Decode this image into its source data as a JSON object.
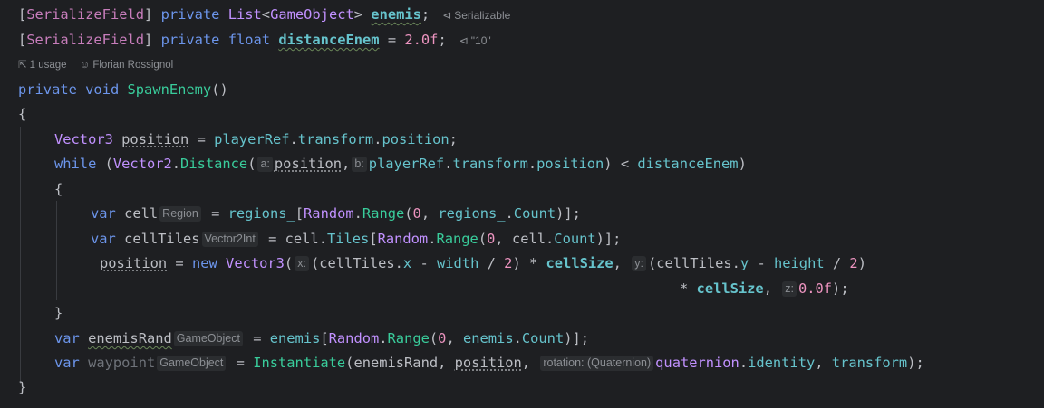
{
  "editor": {
    "field1": {
      "attribute": "SerializeField",
      "modifier": "private",
      "type": "List",
      "generic": "GameObject",
      "name": "enemis",
      "inlay": "Serializable"
    },
    "field2": {
      "attribute": "SerializeField",
      "modifier": "private",
      "type": "float",
      "name": "distanceEnem",
      "value": "2.0f",
      "inlay": "\"10\""
    },
    "meta": {
      "usages": "1 usage",
      "author": "Florian Rossignol"
    },
    "method": {
      "modifier": "private",
      "ret": "void",
      "name": "SpawnEnemy",
      "open_brace": "{",
      "close_brace": "}"
    },
    "hints": {
      "a": "a:",
      "b": "b:",
      "region": "Region",
      "vector2int": "Vector2Int",
      "x": "x:",
      "y": "y:",
      "z": "z:",
      "gameobject1": "GameObject",
      "gameobject2": "GameObject",
      "rotation": "rotation: (Quaternion)"
    },
    "code": {
      "vector3": "Vector3",
      "position": "position",
      "playerRef": "playerRef",
      "transform": "transform",
      "while": "while",
      "vector2": "Vector2",
      "distance": "Distance",
      "distanceEnem": "distanceEnem",
      "var": "var",
      "cell": "cell",
      "regions": "regions_",
      "random": "Random",
      "range": "Range",
      "count": "Count",
      "cellTiles": "cellTiles",
      "tiles": "Tiles",
      "new": "new",
      "x": "x",
      "width": "width",
      "cellSize": "cellSize",
      "y": "y",
      "height": "height",
      "zero": "0",
      "two": "2",
      "zerof": "0.0f",
      "enemisRand": "enemisRand",
      "enemis": "enemis",
      "waypoint": "waypoint",
      "instantiate": "Instantiate",
      "quaternion": "quaternion",
      "identity": "identity"
    }
  }
}
